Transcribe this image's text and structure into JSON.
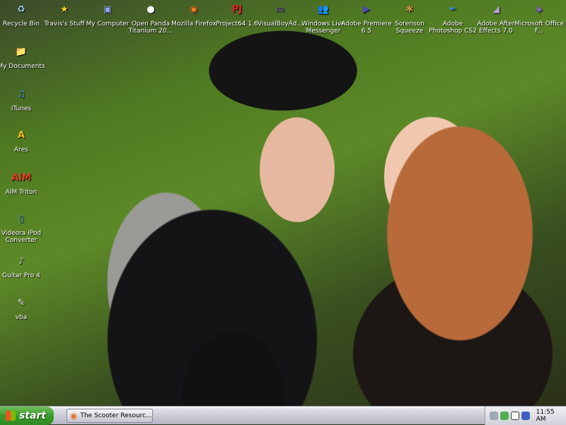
{
  "desktop_icons_top": [
    {
      "label": "Recycle Bin",
      "icon": "recycle-bin-icon",
      "glyph": "♻",
      "color": "#9fd0e8"
    },
    {
      "label": "Travis's Stuff",
      "icon": "star-icon",
      "glyph": "★",
      "color": "#f5d020"
    },
    {
      "label": "My Computer",
      "icon": "computer-icon",
      "glyph": "▣",
      "color": "#8aa8e8"
    },
    {
      "label": "Open Panda Titanium 20...",
      "icon": "panda-icon",
      "glyph": "●",
      "color": "#ffffff"
    },
    {
      "label": "Mozilla Firefox",
      "icon": "firefox-icon",
      "glyph": "◉",
      "color": "#f08020"
    },
    {
      "label": "Project64 1.6",
      "icon": "project64-icon",
      "glyph": "PJ",
      "color": "#e02020"
    },
    {
      "label": "VisualBoyAd...",
      "icon": "gameboy-icon",
      "glyph": "▭",
      "color": "#6a3ad0"
    },
    {
      "label": "Windows Live Messenger",
      "icon": "messenger-icon",
      "glyph": "👥",
      "color": "#50b050"
    },
    {
      "label": "Adobe Premiere 6.5",
      "icon": "premiere-icon",
      "glyph": "▶",
      "color": "#4a4ab0"
    },
    {
      "label": "Sorenson Squeeze",
      "icon": "squeeze-icon",
      "glyph": "✱",
      "color": "#c09040"
    },
    {
      "label": "Adobe Photoshop CS2",
      "icon": "photoshop-icon",
      "glyph": "✒",
      "color": "#3a90d0"
    },
    {
      "label": "Adobe After Effects 7.0",
      "icon": "after-effects-icon",
      "glyph": "◢",
      "color": "#b0a0d0"
    },
    {
      "label": "Microsoft Office F...",
      "icon": "office-icon",
      "glyph": "◈",
      "color": "#8a70d0"
    }
  ],
  "desktop_icons_left": [
    {
      "label": "My Documents",
      "icon": "folder-icon",
      "glyph": "📁",
      "color": "#f0d060"
    },
    {
      "label": "iTunes",
      "icon": "itunes-icon",
      "glyph": "♫",
      "color": "#4a90e0"
    },
    {
      "label": "Ares",
      "icon": "ares-icon",
      "glyph": "A",
      "color": "#f0c020"
    },
    {
      "label": "AIM Triton",
      "icon": "aim-icon",
      "glyph": "AIM",
      "color": "#e04020"
    },
    {
      "label": "Videora iPod Converter",
      "icon": "videora-icon",
      "glyph": "▯",
      "color": "#50a0d0"
    },
    {
      "label": "Guitar Pro 4",
      "icon": "guitar-pro-icon",
      "glyph": "♪",
      "color": "#c0c0c0"
    },
    {
      "label": "vba",
      "icon": "document-icon",
      "glyph": "✎",
      "color": "#e8e8e8"
    }
  ],
  "taskbar": {
    "start_label": "start",
    "task_label": "The Scooter Resourc...",
    "clock": "11:55 AM"
  }
}
